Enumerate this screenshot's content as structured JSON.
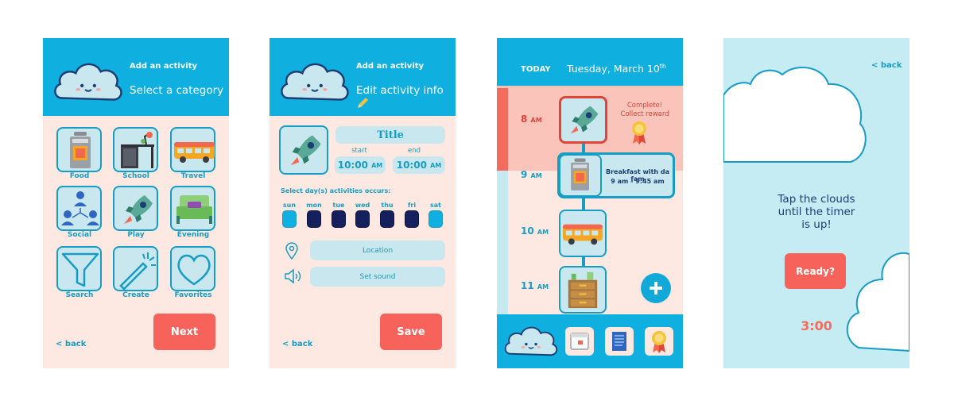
{
  "screen1": {
    "header_sub": "Add an activity",
    "header_title": "Select a category",
    "categories": [
      {
        "label": "Food",
        "icon": "stove-icon"
      },
      {
        "label": "School",
        "icon": "desk-icon"
      },
      {
        "label": "Travel",
        "icon": "bus-icon"
      },
      {
        "label": "Social",
        "icon": "people-icon"
      },
      {
        "label": "Play",
        "icon": "rocket-icon"
      },
      {
        "label": "Evening",
        "icon": "bed-icon"
      },
      {
        "label": "Search",
        "icon": "funnel-icon"
      },
      {
        "label": "Create",
        "icon": "magic-wand-icon"
      },
      {
        "label": "Favorites",
        "icon": "heart-icon"
      }
    ],
    "back": "< back",
    "next": "Next"
  },
  "screen2": {
    "header_sub": "Add an activity",
    "header_title": "Edit activity info",
    "title_placeholder": "Title",
    "start_label": "start",
    "end_label": "end",
    "start_time": "10:00",
    "start_ampm": "AM",
    "end_time": "10:00",
    "end_ampm": "AM",
    "days_prompt": "Select day(s) activities occurs:",
    "days": [
      {
        "label": "sun",
        "selected": false
      },
      {
        "label": "mon",
        "selected": true
      },
      {
        "label": "tue",
        "selected": true
      },
      {
        "label": "wed",
        "selected": true
      },
      {
        "label": "thu",
        "selected": true
      },
      {
        "label": "fri",
        "selected": true
      },
      {
        "label": "sat",
        "selected": false
      }
    ],
    "location": "Location",
    "set_sound": "Set sound",
    "back": "< back",
    "save": "Save"
  },
  "screen3": {
    "today": "TODAY",
    "date": "Tuesday, March 10",
    "date_suffix": "th",
    "hours": [
      {
        "hour": "8",
        "ampm": "AM"
      },
      {
        "hour": "9",
        "ampm": "AM"
      },
      {
        "hour": "10",
        "ampm": "AM"
      },
      {
        "hour": "11",
        "ampm": "AM"
      }
    ],
    "complete_line1": "Complete!",
    "complete_line2": "Collect reward",
    "event_title": "Breakfast with da fam",
    "event_time": "9 am - 9:45 am",
    "add_icon": "plus-icon",
    "nav_icons": [
      "cloud-icon",
      "calendar-icon",
      "notes-icon",
      "ribbon-icon"
    ]
  },
  "screen4": {
    "back": "< back",
    "message_line1": "Tap the clouds",
    "message_line2": "until the timer",
    "message_line3": "is up!",
    "ready": "Ready?",
    "timer": "3:00"
  },
  "colors": {
    "header_blue": "#0fb0e0",
    "outline_blue": "#179dc4",
    "tile_fill": "#c8e7ee",
    "peach_bg": "#fde9e1",
    "coral": "#f7635a",
    "navy_day": "#16205e",
    "pale_blue_bg": "#c6ecf3"
  }
}
